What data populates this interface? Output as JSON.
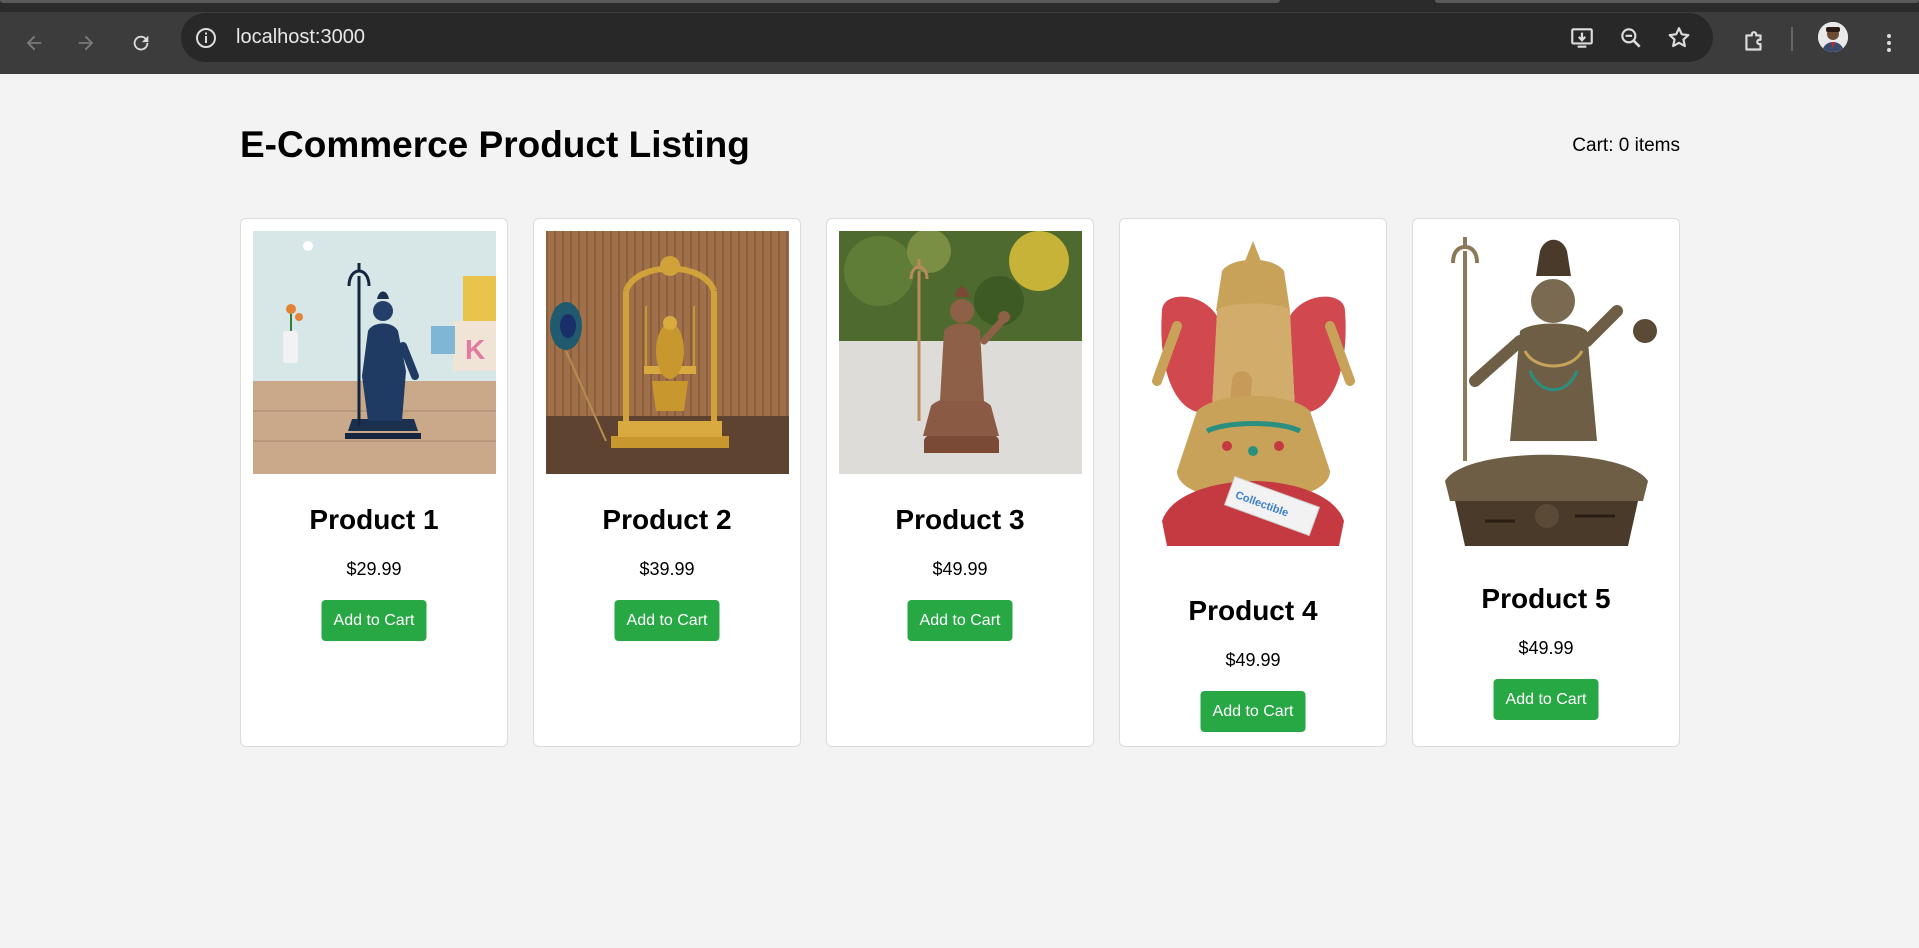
{
  "browser": {
    "url": "localhost:3000"
  },
  "page": {
    "title": "E-Commerce Product Listing",
    "cart_status": "Cart: 0 items"
  },
  "products": [
    {
      "name": "Product 1",
      "price": "$29.99",
      "button": "Add to Cart",
      "image": "blue-shiva-statue"
    },
    {
      "name": "Product 2",
      "price": "$39.99",
      "button": "Add to Cart",
      "image": "brass-krishna-swing"
    },
    {
      "name": "Product 3",
      "price": "$49.99",
      "button": "Add to Cart",
      "image": "copper-shiva-statue"
    },
    {
      "name": "Product 4",
      "price": "$49.99",
      "button": "Add to Cart",
      "image": "ganesha-statue"
    },
    {
      "name": "Product 5",
      "price": "$49.99",
      "button": "Add to Cart",
      "image": "bronze-shiva-statue"
    }
  ],
  "colors": {
    "button": "#28a745",
    "page_bg": "#f3f3f3",
    "chrome_bg": "#3c3c3c"
  }
}
